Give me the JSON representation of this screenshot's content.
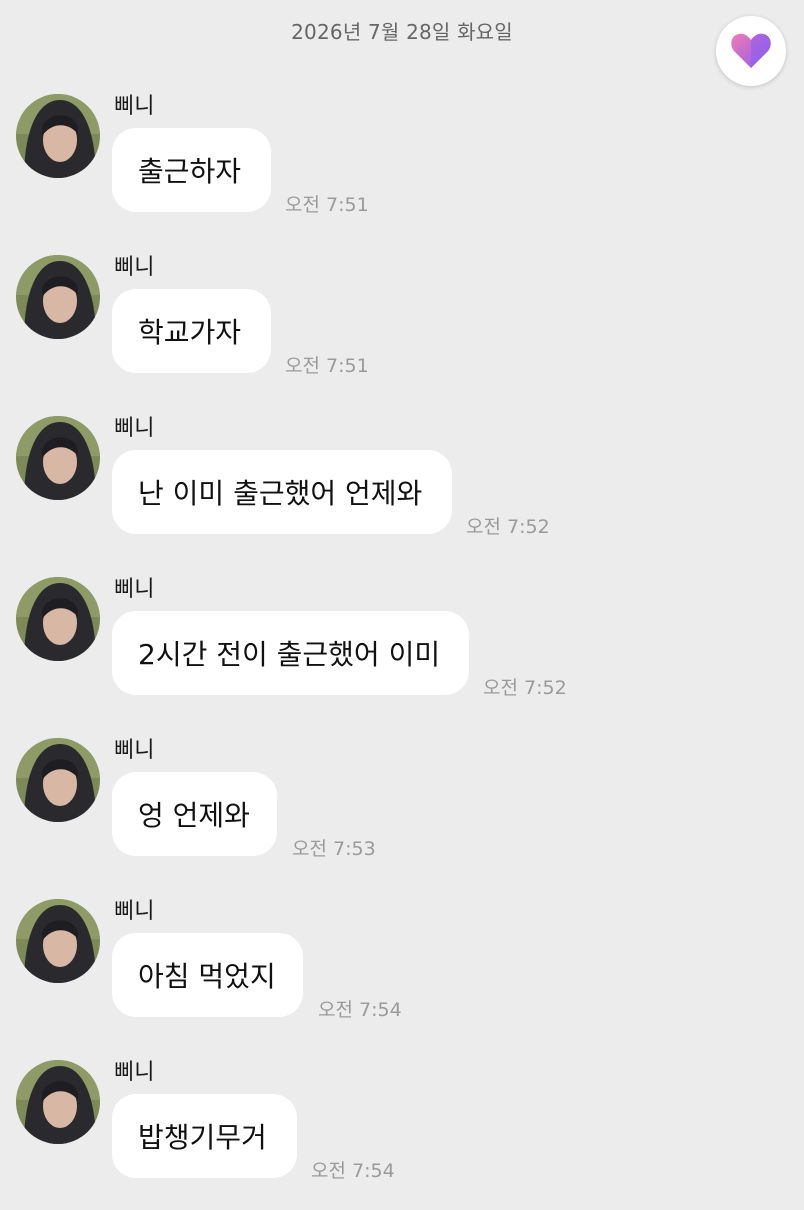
{
  "date_header": "2026년 7월 28일 화요일",
  "accent": {
    "heart_left": "#f07ab4",
    "heart_right": "#8c5cf0"
  },
  "messages": [
    {
      "sender": "삐니",
      "text": "출근하자",
      "time": "오전 7:51"
    },
    {
      "sender": "삐니",
      "text": "학교가자",
      "time": "오전 7:51"
    },
    {
      "sender": "삐니",
      "text": "난 이미 출근했어 언제와",
      "time": "오전 7:52"
    },
    {
      "sender": "삐니",
      "text": "2시간 전이 출근했어 이미",
      "time": "오전 7:52"
    },
    {
      "sender": "삐니",
      "text": "엉 언제와",
      "time": "오전 7:53"
    },
    {
      "sender": "삐니",
      "text": "아침 먹었지",
      "time": "오전 7:54"
    },
    {
      "sender": "삐니",
      "text": "밥챙기무거",
      "time": "오전 7:54"
    }
  ]
}
